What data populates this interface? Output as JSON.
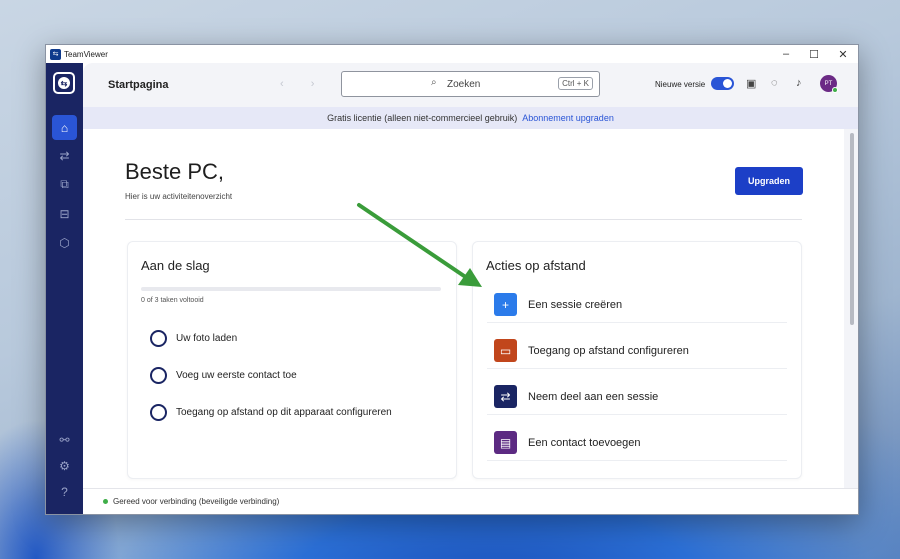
{
  "window": {
    "title": "TeamViewer"
  },
  "header": {
    "page_title": "Startpagina",
    "search_placeholder": "Zoeken",
    "search_shortcut": "Ctrl + K",
    "new_version_label": "Nieuwe versie",
    "new_version_enabled": true,
    "avatar_initials": "PT"
  },
  "banner": {
    "text": "Gratis licentie (alleen niet-commercieel gebruik)",
    "link": "Abonnement upgraden"
  },
  "main": {
    "greeting": "Beste PC,",
    "subtitle": "Hier is uw activiteitenoverzicht",
    "upgrade_button": "Upgraden"
  },
  "getting_started": {
    "title": "Aan de slag",
    "progress_text": "0 of 3 taken voltooid",
    "progress_fraction": 0,
    "tasks": [
      {
        "label": "Uw foto laden"
      },
      {
        "label": "Voeg uw eerste contact toe"
      },
      {
        "label": "Toegang op afstand op dit apparaat configureren"
      }
    ]
  },
  "remote_actions": {
    "title": "Acties op afstand",
    "items": [
      {
        "label": "Een sessie creëren",
        "icon": "plus-icon",
        "color": "#2b7bea"
      },
      {
        "label": "Toegang op afstand configureren",
        "icon": "monitor-gear-icon",
        "color": "#c1461c"
      },
      {
        "label": "Neem deel aan een sessie",
        "icon": "swap-arrows-icon",
        "color": "#1a2563"
      },
      {
        "label": "Een contact toevoegen",
        "icon": "contact-card-icon",
        "color": "#5c2a82"
      }
    ]
  },
  "status": {
    "text": "Gereed voor verbinding (beveiligde verbinding)"
  },
  "colors": {
    "accent": "#2a55d6",
    "sidebar": "#1a2563",
    "annotation_arrow": "#3a9c3a"
  }
}
